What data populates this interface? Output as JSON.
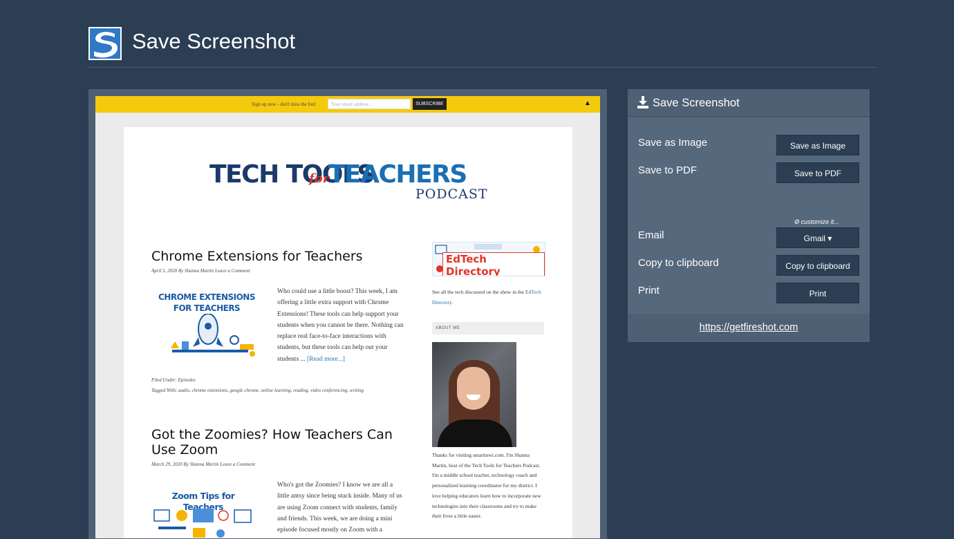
{
  "app": {
    "title": "Save Screenshot",
    "logo_icon": "fireshot-logo-icon"
  },
  "preview": {
    "topbar": {
      "text": "Sign up now - don't miss the fun!",
      "email_placeholder": "Your email address...",
      "subscribe_label": "SUBSCRIBE",
      "arrow": "▲"
    },
    "site_logo": {
      "tech": "TECH TOOLS",
      "for": "for",
      "teachers": "TEACHERS",
      "podcast": "PODCAST"
    },
    "posts": [
      {
        "title": "Chrome Extensions for Teachers",
        "meta": "April 5, 2020 By Shanna Martin Leave a Comment",
        "thumb_title": "CHROME EXTENSIONS FOR TEACHERS",
        "excerpt": "Who could use a little boost? This week, I am offering a little extra support with Chrome Extensions! These tools can help support your students when you cannot be there. Nothing can replace real face-to-face interactions with students, but these tools can help out your students ...",
        "read_more": "[Read more...]",
        "filed_under": "Filed Under: Episodes",
        "tagged_with": "Tagged With: audio, chrome extensions, google chrome, online learning, reading, video conferencing, writing"
      },
      {
        "title": "Got the Zoomies? How Teachers Can Use Zoom",
        "meta": "March 29, 2020 By Shanna Martin Leave a Comment",
        "thumb_title": "Zoom Tips for Teachers",
        "excerpt": "Who's got the Zoomies? I know we are all a little antsy since being stuck inside. Many of us are using Zoom connect with students, family and friends. This week, we are doing a mini episode focused mostly on Zoom with a"
      }
    ],
    "sidebar": {
      "banner_text": "EdTech Directory",
      "directory_text": "See all the tech discussed on the show in the",
      "directory_link": "EdTech Directory.",
      "about_heading": "ABOUT ME",
      "about_text": "Thanks for visiting smartinwi.com. I'm Shanna Martin, host of the Tech Tools for Teachers Podcast. I'm a middle school teacher, technology coach and personalized learning coordinator for my district. I love helping educators learn how to incorporate new technologies into their classrooms and try to make their lives a little easier."
    }
  },
  "panel": {
    "title": "Save Screenshot",
    "header_icon": "download-icon",
    "rows": {
      "save_image_label": "Save as Image",
      "save_image_btn": "Save as Image",
      "save_pdf_label": "Save to PDF",
      "save_pdf_btn": "Save to PDF",
      "customize": "customize it...",
      "email_label": "Email",
      "email_btn": "Gmail ▾",
      "clipboard_label": "Copy to clipboard",
      "clipboard_btn": "Copy to clipboard",
      "print_label": "Print",
      "print_btn": "Print"
    },
    "footer_link": "https://getfireshot.com"
  }
}
